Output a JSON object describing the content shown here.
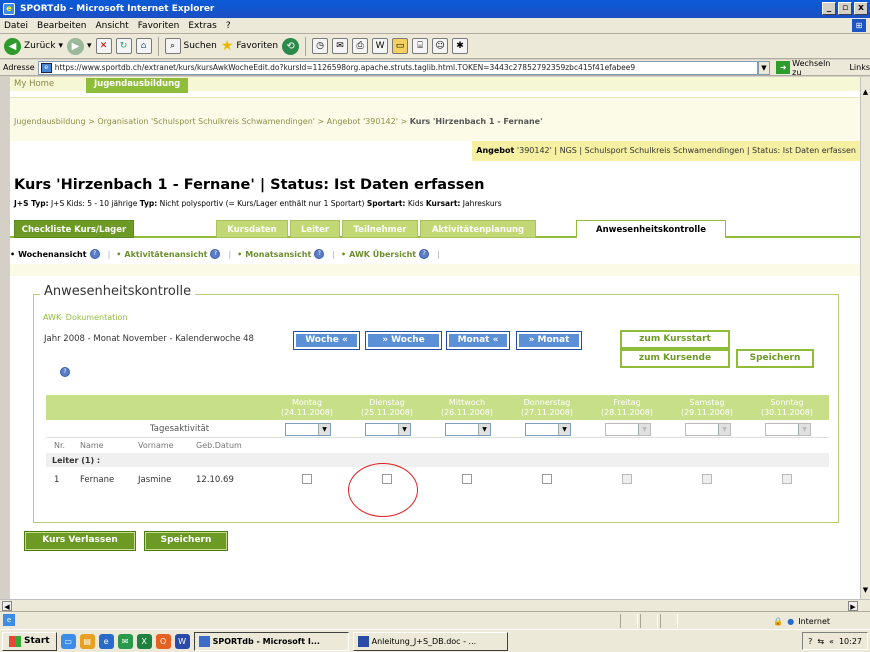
{
  "window": {
    "title": "SPORTdb - Microsoft Internet Explorer",
    "buttons": [
      "_",
      "▫",
      "x"
    ]
  },
  "menu": [
    "Datei",
    "Bearbeiten",
    "Ansicht",
    "Favoriten",
    "Extras",
    "?"
  ],
  "toolbar": {
    "back": "Zurück",
    "search": "Suchen",
    "favorites": "Favoriten"
  },
  "address": {
    "label": "Adresse",
    "url": "https://www.sportdb.ch/extranet/kurs/kursAwkWocheEdit.do?kursId=1126598org.apache.struts.taglib.html.TOKEN=3443c27852792359zbc415f41efabee9",
    "go": "Wechseln zu",
    "links": "Links"
  },
  "nav": {
    "home": "My Home",
    "section": "Jugendausbildung"
  },
  "breadcrumb": {
    "path": "Jugendausbildung > Organisation 'Schulsport Schulkreis Schwamendingen' > Angebot '390142' > ",
    "current": "Kurs 'Hirzenbach 1 - Fernane'"
  },
  "angebot": {
    "label": "Angebot",
    "text": "'390142' | NGS | Schulsport Schulkreis Schwamendingen | Status: Ist Daten erfassen"
  },
  "kurs": {
    "title": "Kurs 'Hirzenbach 1 - Fernane' | Status: Ist Daten erfassen",
    "info_l1": "J+S Typ:",
    "info_v1": "J+S Kids: 5 - 10 jährige",
    "info_l2": "Typ:",
    "info_v2": "Nicht polysportiv (= Kurs/Lager enthält nur 1 Sportart)",
    "info_l3": "Sportart:",
    "info_v3": "Kids",
    "info_l4": "Kursart:",
    "info_v4": "Jahreskurs"
  },
  "tabs": [
    "Checkliste Kurs/Lager",
    "Kursdaten",
    "Leiter",
    "Teilnehmer",
    "Aktivitätenplanung",
    "Anwesenheitskontrolle"
  ],
  "subtabs": [
    "Wochenansicht",
    "Aktivitätenansicht",
    "Monatsansicht",
    "AWK Übersicht"
  ],
  "panel": {
    "legend": "Anwesenheitskontrolle",
    "awk_link": "AWK- Dokumentation",
    "period": "Jahr 2008 - Monat November - Kalenderwoche 48",
    "btn_woche_prev": "Woche «",
    "btn_woche_next": "» Woche",
    "btn_monat_prev": "Monat «",
    "btn_monat_next": "» Monat",
    "btn_kursstart": "zum Kursstart",
    "btn_kursende": "zum Kursende",
    "btn_speichern": "Speichern"
  },
  "days": [
    {
      "name": "Montag",
      "date": "(24.11.2008)"
    },
    {
      "name": "Dienstag",
      "date": "(25.11.2008)"
    },
    {
      "name": "Mittwoch",
      "date": "(26.11.2008)"
    },
    {
      "name": "Donnerstag",
      "date": "(27.11.2008)"
    },
    {
      "name": "Freitag",
      "date": "(28.11.2008)"
    },
    {
      "name": "Samstag",
      "date": "(29.11.2008)"
    },
    {
      "name": "Sonntag",
      "date": "(30.11.2008)"
    }
  ],
  "table": {
    "tagesaktivitaet": "Tagesaktivität",
    "headers": [
      "Nr.",
      "Name",
      "Vorname",
      "Geb.Datum"
    ],
    "group": "Leiter (1) :",
    "row": {
      "nr": "1",
      "name": "Fernane",
      "vorname": "Jasmine",
      "geb": "12.10.69"
    }
  },
  "bottom": {
    "verlassen": "Kurs Verlassen",
    "speichern": "Speichern"
  },
  "status": {
    "zone": "Internet"
  },
  "taskbar": {
    "start": "Start",
    "task1": "SPORTdb - Microsoft I...",
    "task2": "Anleitung_J+S_DB.doc - ...",
    "clock": "10:27"
  }
}
